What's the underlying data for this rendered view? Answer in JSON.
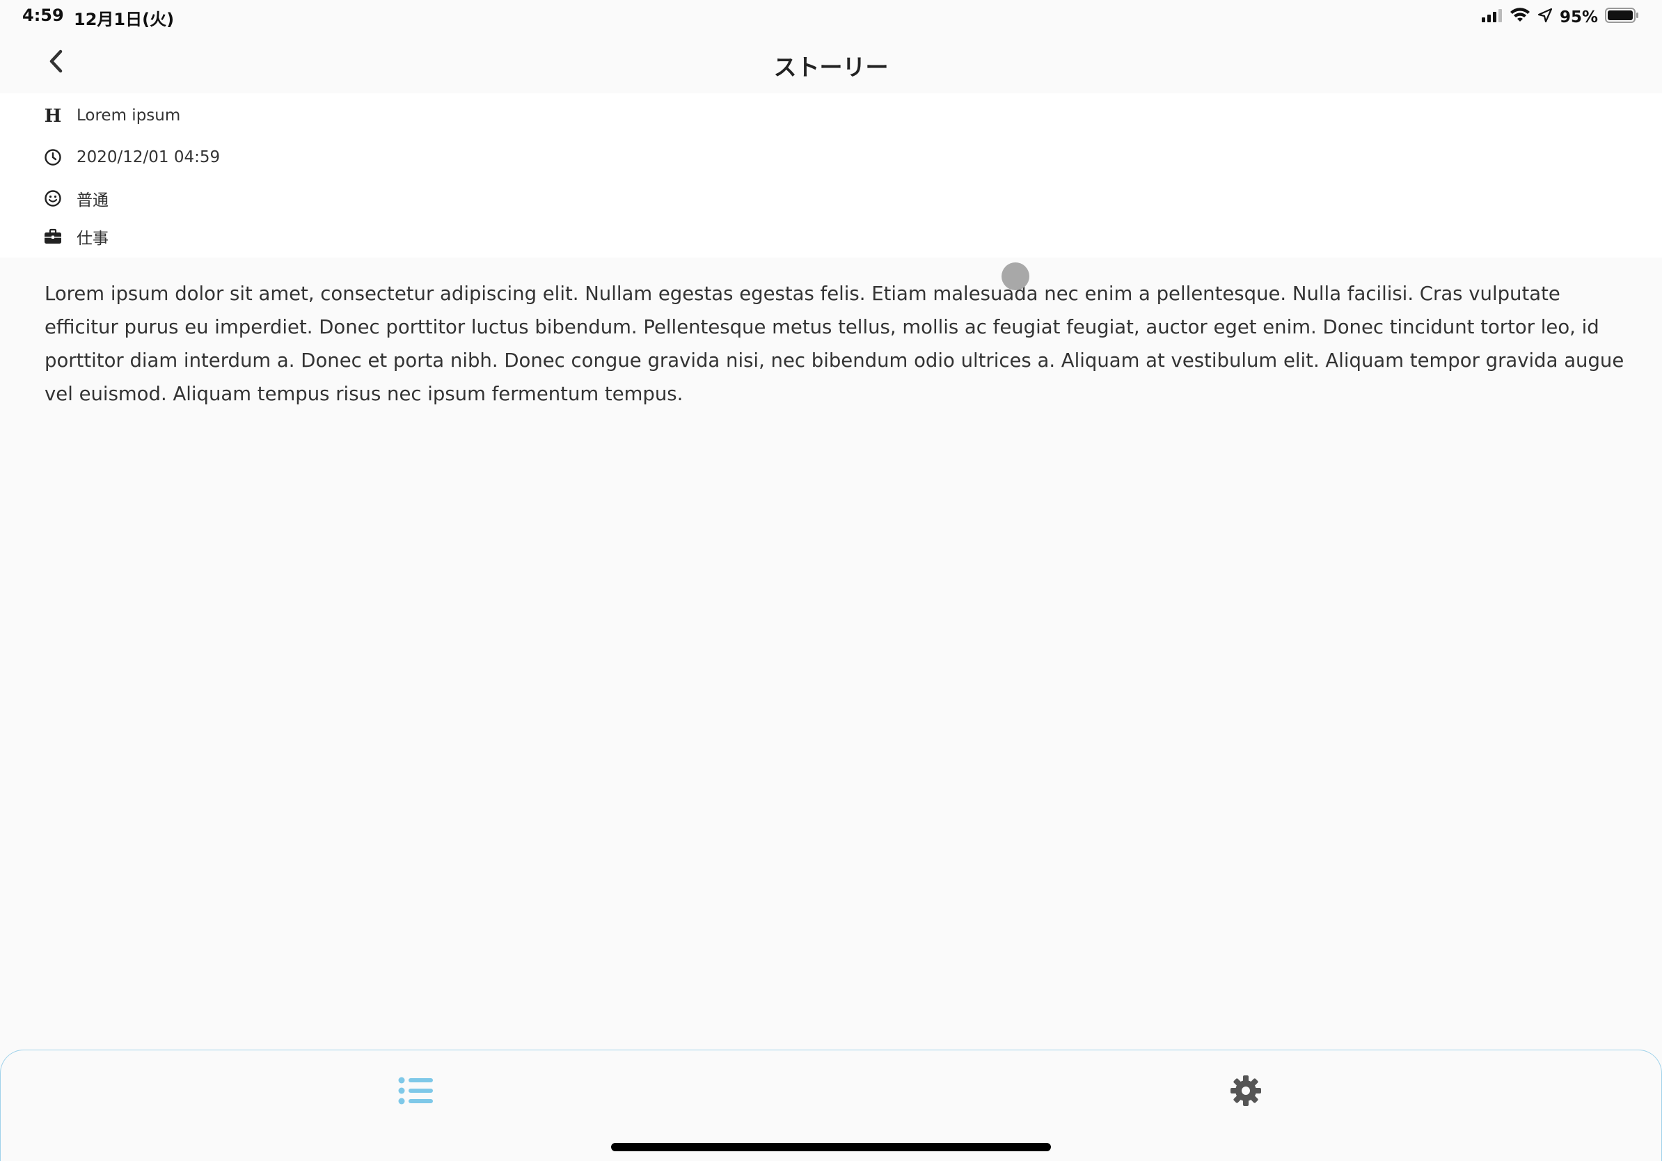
{
  "status_bar": {
    "time": "4:59",
    "date": "12月1日(火)",
    "battery_percent": "95%",
    "battery_level": 0.95,
    "icons": [
      "cellular-signal-icon",
      "wifi-icon",
      "location-arrow-icon",
      "battery-icon"
    ]
  },
  "nav": {
    "title": "ストーリー",
    "back_icon": "chevron-left-icon"
  },
  "meta": {
    "title": "Lorem ipsum",
    "datetime": "2020/12/01 04:59",
    "mood": "普通",
    "category": "仕事"
  },
  "story": {
    "body": "Lorem ipsum dolor sit amet, consectetur adipiscing elit. Nullam egestas egestas felis. Etiam malesuada nec enim a pellentesque. Nulla facilisi. Cras vulputate efficitur purus eu imperdiet. Donec porttitor luctus bibendum. Pellentesque metus tellus, mollis ac feugiat feugiat, auctor eget enim. Donec tincidunt tortor leo, id porttitor diam interdum a. Donec et porta nibh. Donec congue gravida nisi, nec bibendum odio ultrices a. Aliquam at vestibulum elit. Aliquam tempor gravida augue vel euismod. Aliquam tempus risus nec ipsum fermentum tempus."
  },
  "tabs": [
    {
      "icon": "list-icon",
      "active": true
    },
    {
      "icon": "gear-icon",
      "active": false
    }
  ],
  "colors": {
    "accent": "#7ec8e8",
    "background": "#fafafa",
    "text": "#333333",
    "inactive_icon": "#555555"
  }
}
